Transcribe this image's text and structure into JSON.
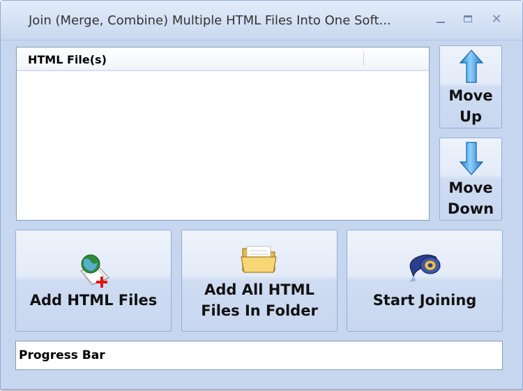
{
  "window": {
    "title": "Join (Merge, Combine) Multiple HTML Files Into One Soft...",
    "controls": {
      "minimize": "minimize",
      "maximize": "maximize",
      "close": "✕"
    }
  },
  "file_list": {
    "columns": [
      "HTML File(s)"
    ],
    "rows": []
  },
  "side_buttons": {
    "move_up_line1": "Move",
    "move_up_line2": "Up",
    "move_down_line1": "Move",
    "move_down_line2": "Down"
  },
  "action_buttons": {
    "add_files": "Add HTML Files",
    "add_folder_line1": "Add All HTML",
    "add_folder_line2": "Files In Folder",
    "start": "Start Joining"
  },
  "progress": {
    "label": "Progress Bar"
  },
  "icons": {
    "move_up": "up-arrow-icon",
    "move_down": "down-arrow-icon",
    "add_files": "html-file-add-icon",
    "add_folder": "folder-icon",
    "start": "tape-icon"
  },
  "colors": {
    "window_bg": "#c6d6ef",
    "arrow_blue": "#2f9ee8"
  }
}
